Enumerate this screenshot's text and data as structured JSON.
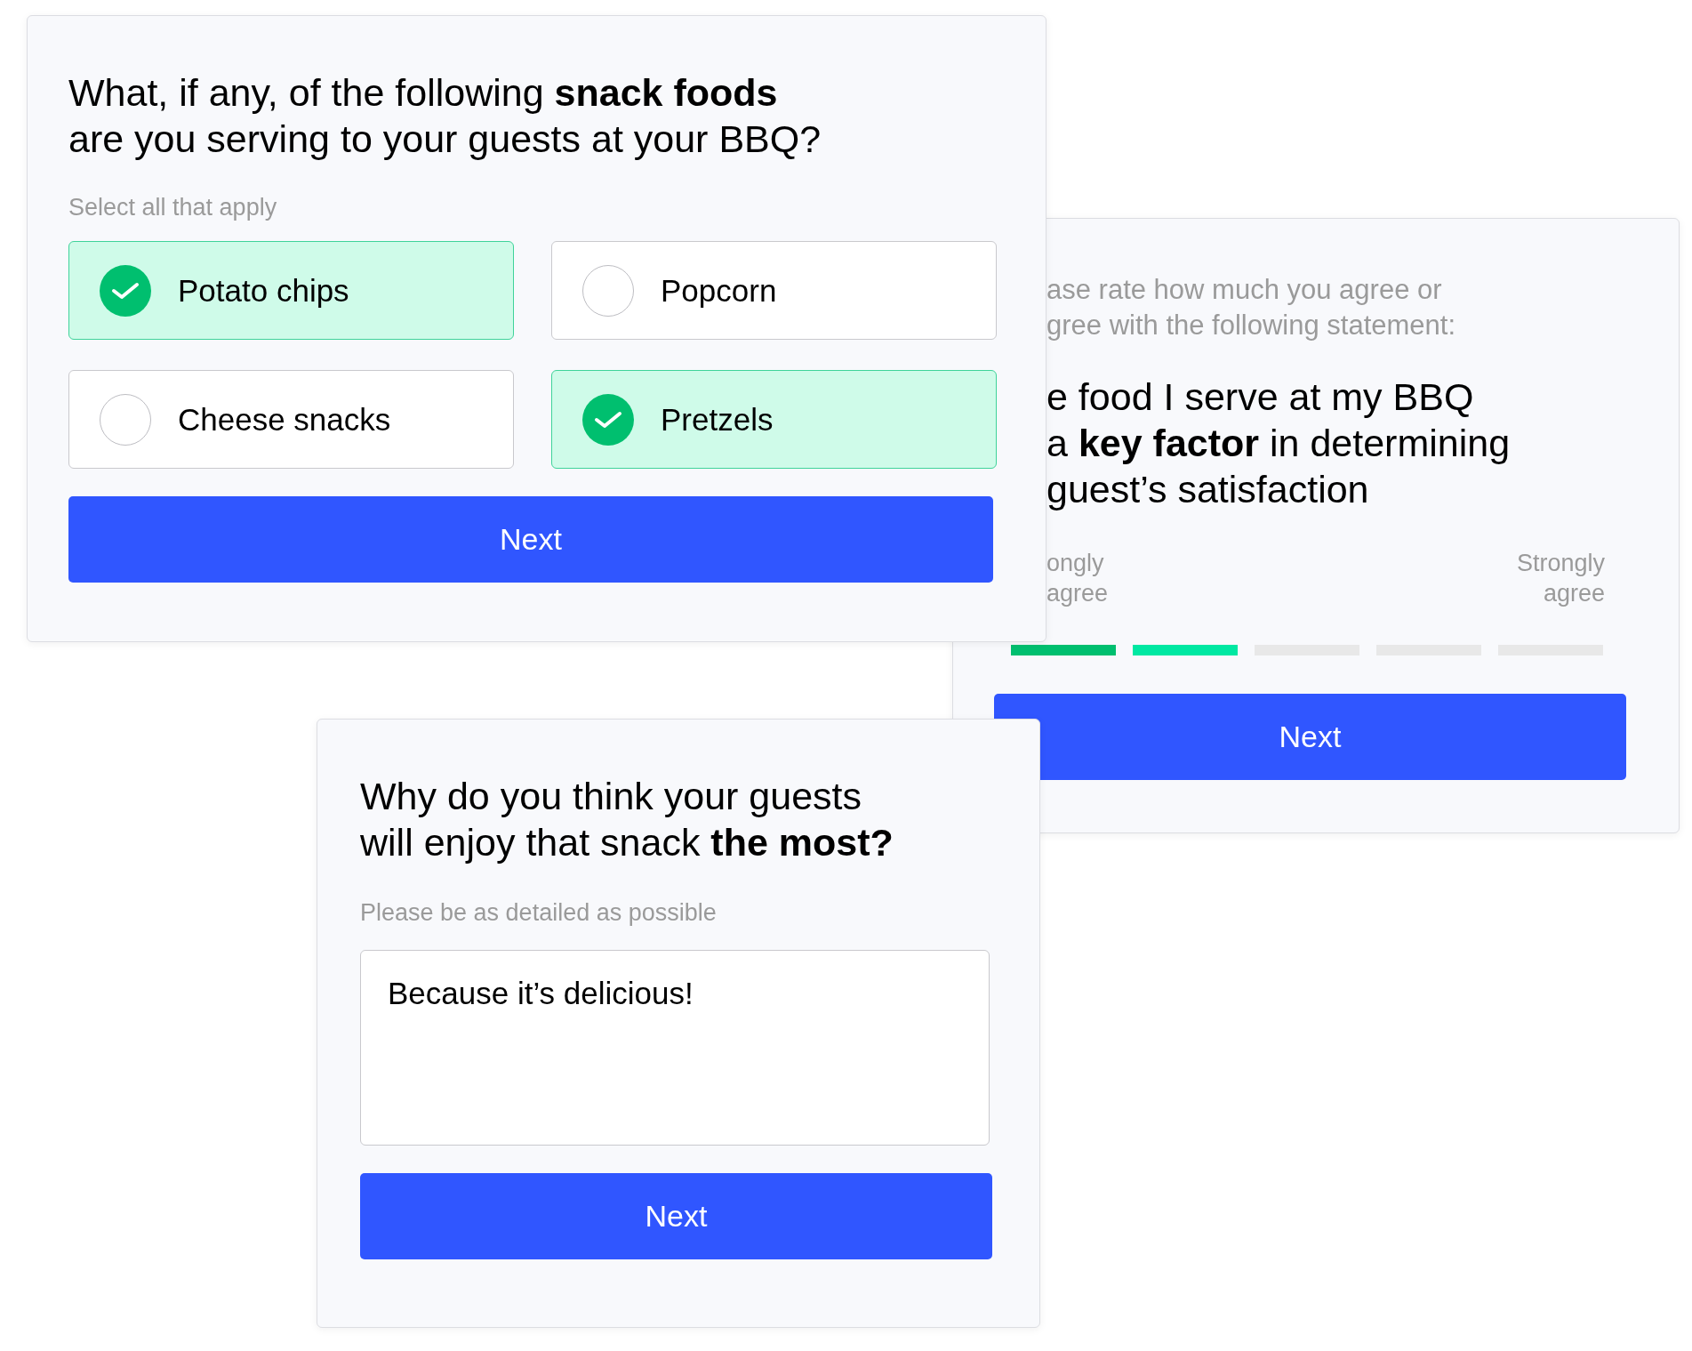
{
  "snack_card": {
    "question": "What, if any, of the following **snack foods**\nare you serving to your guests at your BBQ?",
    "hint": "Select all that apply",
    "options": [
      {
        "label": "Potato chips",
        "checked": true
      },
      {
        "label": "Popcorn",
        "checked": false
      },
      {
        "label": "Cheese snacks",
        "checked": false
      },
      {
        "label": "Pretzels",
        "checked": true
      }
    ],
    "button": "Next"
  },
  "rating_card": {
    "instruction": [
      "ase rate how much you agree or",
      "gree with the following statement:"
    ],
    "statement": [
      "e food I serve at my BBQ",
      "a **key factor** in determining",
      "guest’s satisfaction"
    ],
    "left_label": [
      "ongly",
      "agree"
    ],
    "right_label": [
      "Strongly",
      "agree"
    ],
    "scale": [
      {
        "color": "#00bf6f"
      },
      {
        "color": "#00e8a2"
      },
      {
        "color": "#e8e8e8"
      },
      {
        "color": "#e8e8e8"
      },
      {
        "color": "#e8e8e8"
      }
    ],
    "button": "Next"
  },
  "reason_card": {
    "question": "Why do you think your guests\nwill enjoy that snack **the most?**",
    "hint": "Please be as detailed as possible",
    "answer": "Because it’s delicious!",
    "button": "Next"
  }
}
